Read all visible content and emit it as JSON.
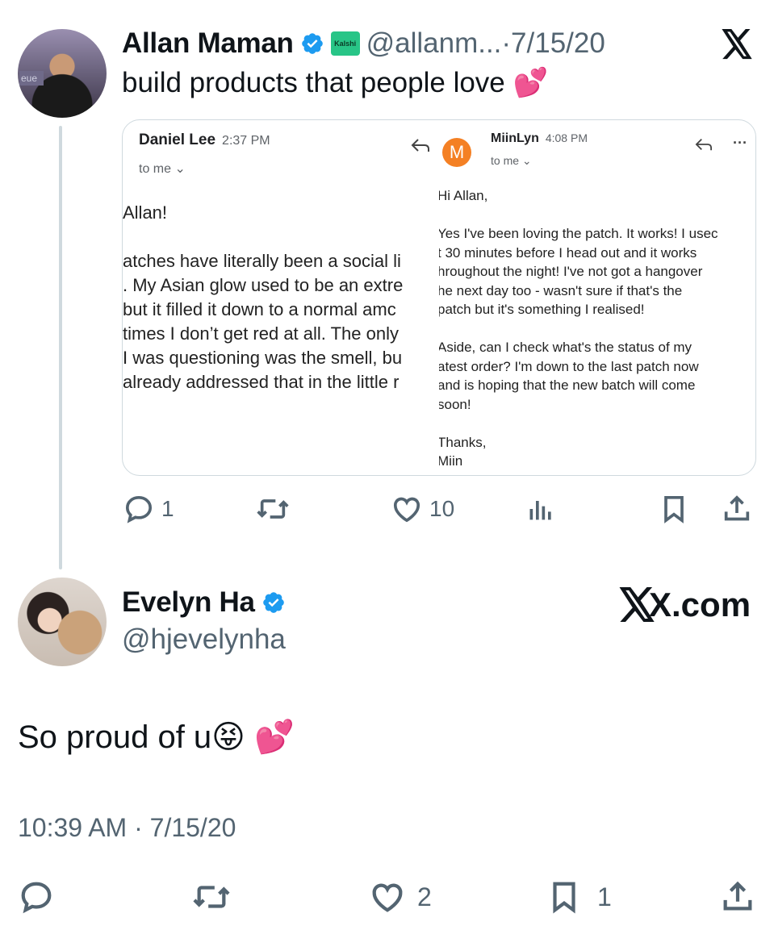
{
  "tweet": {
    "author_name": "Allan Maman",
    "badge_label": "Kalshi",
    "handle_date": "@allanm...·7/15/20",
    "text": "build products that people love 💕",
    "avatar_sign": "eue",
    "image": {
      "left_email": {
        "sender": "Daniel Lee",
        "time": "2:37 PM",
        "to": "to me ⌄",
        "lines": [
          "Allan!",
          "",
          "atches have literally been a social li",
          ". My Asian glow used to be an extre",
          " but it filled it down to a normal amc",
          "times I don’t get red at all. The only",
          "I was questioning was the smell, bu",
          "already addressed that in the little r"
        ]
      },
      "right_email": {
        "avatar_letter": "M",
        "sender": "MiinLyn",
        "time": "4:08 PM",
        "to": "to me ⌄",
        "more": "···",
        "lines": [
          "Hi Allan,",
          "",
          "Yes I've been loving the patch. It works! I usec",
          "t 30 minutes before I head out and it works",
          "hroughout the night! I've not got a hangover",
          "he next day too - wasn't sure if that's the",
          "patch but it's something I realised!",
          "",
          "Aside, can I check what's the status of my",
          "atest order? I'm down to the last patch now",
          "and is hoping that the new batch will come",
          "soon!",
          "",
          "Thanks,",
          "Miin"
        ]
      }
    },
    "actions": {
      "replies": "1",
      "likes": "10"
    }
  },
  "reply": {
    "author_name": "Evelyn Ha",
    "handle": "@hjevelynha",
    "site_label": "X.com",
    "text": "So proud of u😝 💕",
    "timestamp": "10:39 AM · 7/15/20",
    "actions": {
      "likes": "2",
      "bookmarks": "1"
    }
  },
  "colors": {
    "verified": "#1d9bf0",
    "secondary_text": "#536471",
    "kalshi": "#28c587",
    "email_avatar": "#f48024"
  },
  "icons": [
    "x-logo-icon",
    "verified-badge-icon",
    "reply-icon",
    "repost-icon",
    "like-icon",
    "views-icon",
    "bookmark-icon",
    "share-icon",
    "email-reply-icon",
    "chevron-down-icon"
  ]
}
